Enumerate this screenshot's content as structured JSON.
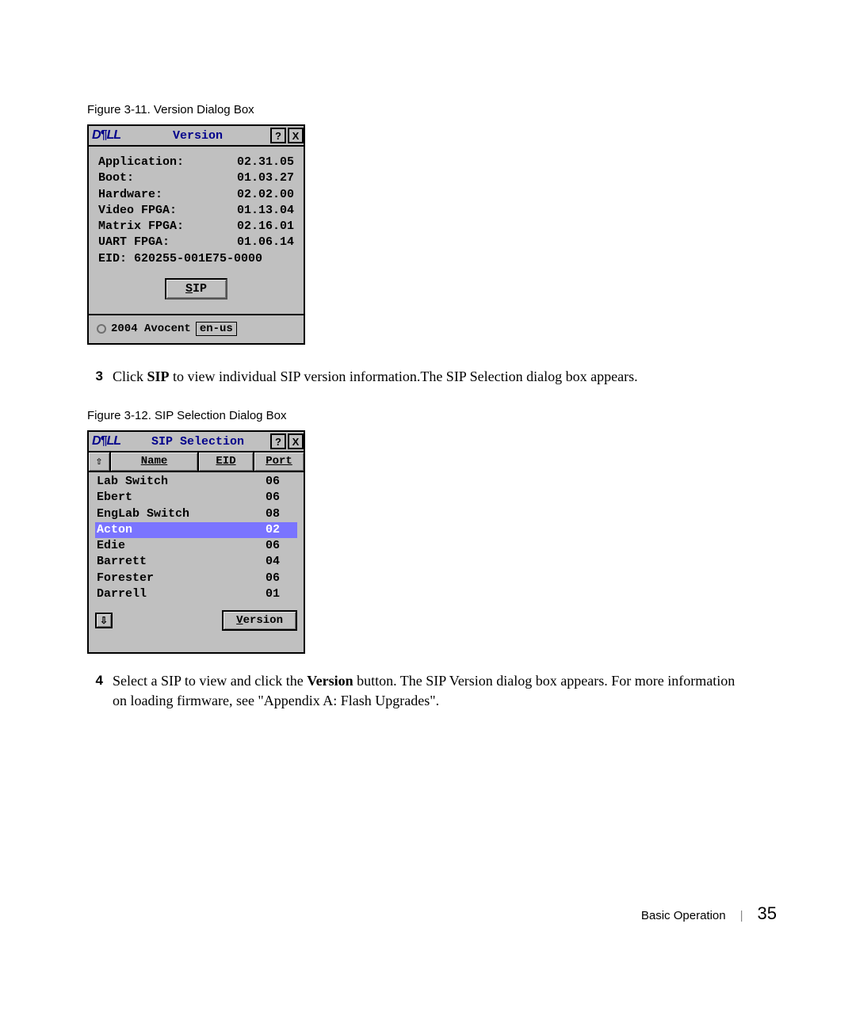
{
  "figure1": {
    "caption": "Figure 3-11.    Version Dialog Box",
    "logo": "D¶LL",
    "title": "Version",
    "help": "?",
    "close": "X",
    "rows": [
      {
        "label": "Application:",
        "value": "02.31.05"
      },
      {
        "label": "Boot:",
        "value": "01.03.27"
      },
      {
        "label": "Hardware:",
        "value": "02.02.00"
      },
      {
        "label": "Video FPGA:",
        "value": "01.13.04"
      },
      {
        "label": "Matrix FPGA:",
        "value": "02.16.01"
      },
      {
        "label": "UART FPGA:",
        "value": "01.06.14"
      }
    ],
    "eid": "EID:   620255-001E75-0000",
    "sip_btn_prefix": "S",
    "sip_btn_rest": "IP",
    "copyright": "2004 Avocent",
    "locale": "en-us"
  },
  "step3": {
    "num": "3",
    "text_a": "Click ",
    "bold": "SIP",
    "text_b": " to view individual SIP version information.The SIP Selection dialog box appears."
  },
  "figure2": {
    "caption": "Figure 3-12.    SIP Selection Dialog Box",
    "logo": "D¶LL",
    "title": "SIP Selection",
    "help": "?",
    "close": "X",
    "sort_glyph": "⇧",
    "down_glyph": "⇩",
    "headers": {
      "name": "Name",
      "eid": "EID",
      "port": "Port"
    },
    "items": [
      {
        "name": "Lab Switch",
        "port": "06",
        "sel": false
      },
      {
        "name": "Ebert",
        "port": "06",
        "sel": false
      },
      {
        "name": "EngLab Switch",
        "port": "08",
        "sel": false
      },
      {
        "name": "Acton",
        "port": "02",
        "sel": true
      },
      {
        "name": "Edie",
        "port": "06",
        "sel": false
      },
      {
        "name": "Barrett",
        "port": "04",
        "sel": false
      },
      {
        "name": "Forester",
        "port": "06",
        "sel": false
      },
      {
        "name": "Darrell",
        "port": "01",
        "sel": false
      }
    ],
    "version_btn_prefix": "V",
    "version_btn_rest": "ersion"
  },
  "step4": {
    "num": "4",
    "text_a": "Select a SIP to view and click the ",
    "bold": "Version",
    "text_b": " button. The SIP Version dialog box appears. For more information on loading firmware, see \"Appendix A: Flash Upgrades\"."
  },
  "page_footer": {
    "section": "Basic Operation",
    "sep": "|",
    "page": "35"
  }
}
